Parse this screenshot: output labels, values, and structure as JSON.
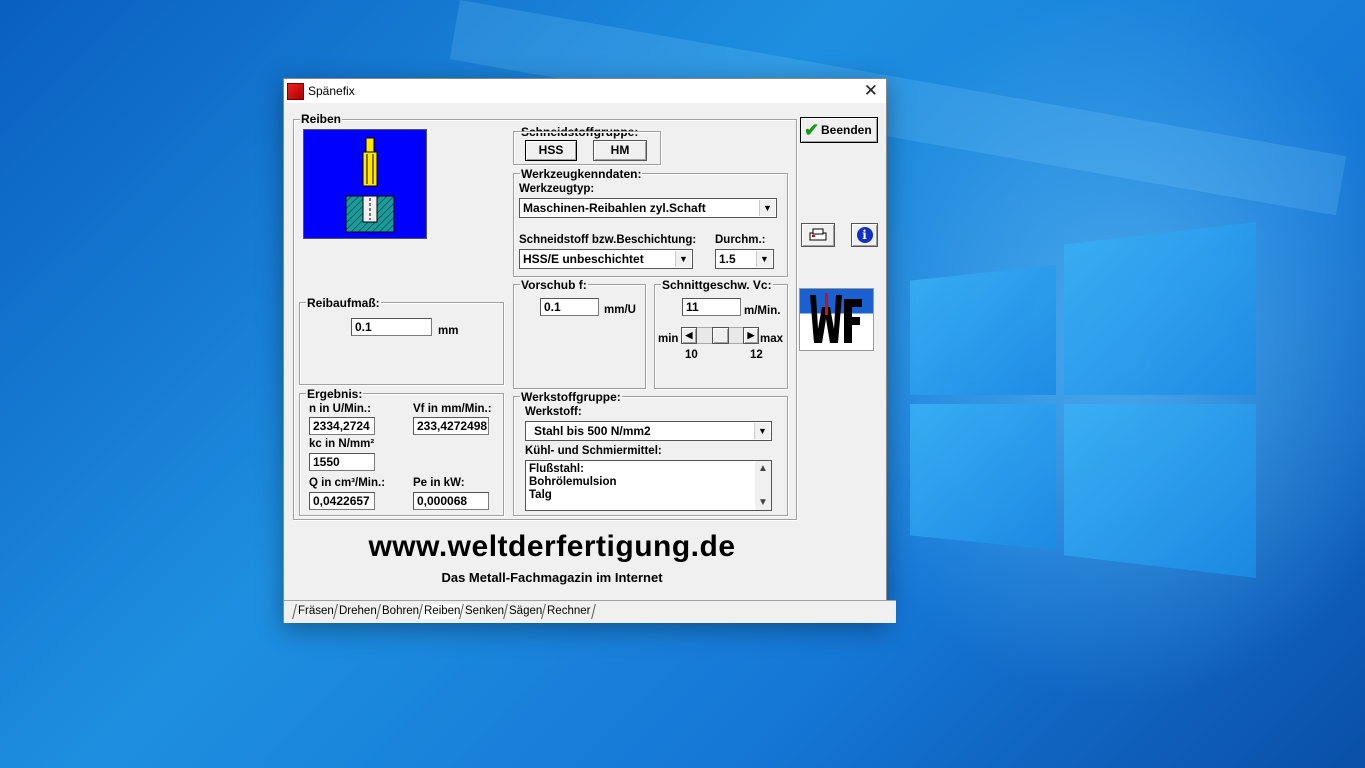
{
  "window": {
    "title": "Spänefix",
    "close_label": "✕"
  },
  "reiben": {
    "group_label": "Reiben"
  },
  "schneidstoffgruppe": {
    "label": "Schneidstoffgruppe:",
    "buttons": [
      "HSS",
      "HM"
    ],
    "active": "HSS"
  },
  "werkzeug": {
    "group_label": "Werkzeugkenndaten:",
    "typ_label": "Werkzeugtyp:",
    "typ_value": "Maschinen-Reibahlen zyl.Schaft",
    "schneidstoff_label": "Schneidstoff bzw.Beschichtung:",
    "schneidstoff_value": "HSS/E unbeschichtet",
    "durchm_label": "Durchm.:",
    "durchm_value": "1.5"
  },
  "vorschub": {
    "label": "Vorschub f:",
    "value": "0.1",
    "unit": "mm/U"
  },
  "schnittgeschw": {
    "label": "Schnittgeschw. Vc:",
    "value": "11",
    "unit": "m/Min.",
    "min_label": "min",
    "max_label": "max",
    "min_value": "10",
    "max_value": "12",
    "slider_fraction": 0.5
  },
  "reibaufmass": {
    "label": "Reibaufmaß:",
    "value": "0.1",
    "unit": "mm"
  },
  "ergebnis": {
    "label": "Ergebnis:",
    "n_label": "n in U/Min.:",
    "n_value": "2334,2724",
    "vf_label": "Vf in mm/Min.:",
    "vf_value": "233,4272498",
    "kc_label": "kc in N/mm²",
    "kc_value": "1550",
    "q_label": "Q in cm³/Min.:",
    "q_value": "0,0422657",
    "pe_label": "Pe in kW:",
    "pe_value": "0,000068"
  },
  "werkstoffgruppe": {
    "label": "Werkstoffgruppe:",
    "werkstoff_label": "Werkstoff:",
    "werkstoff_value": "Stahl bis 500 N/mm2",
    "kuehl_label": "Kühl- und Schmiermittel:",
    "kuehl_items": [
      "Flußstahl:",
      "Bohrölemulsion",
      "Talg"
    ]
  },
  "side": {
    "beenden_label": "Beenden"
  },
  "footer": {
    "url": "www.weltderfertigung.de",
    "tagline": "Das Metall-Fachmagazin im Internet"
  },
  "tabs": [
    "Fräsen",
    "Drehen",
    "Bohren",
    "Reiben",
    "Senken",
    "Sägen",
    "Rechner"
  ],
  "active_tab": "Reiben",
  "colors": {
    "desktop": "#1577d6",
    "tool_bg": "#0000ff",
    "check": "#1a9a1a",
    "info": "#1030c0"
  }
}
